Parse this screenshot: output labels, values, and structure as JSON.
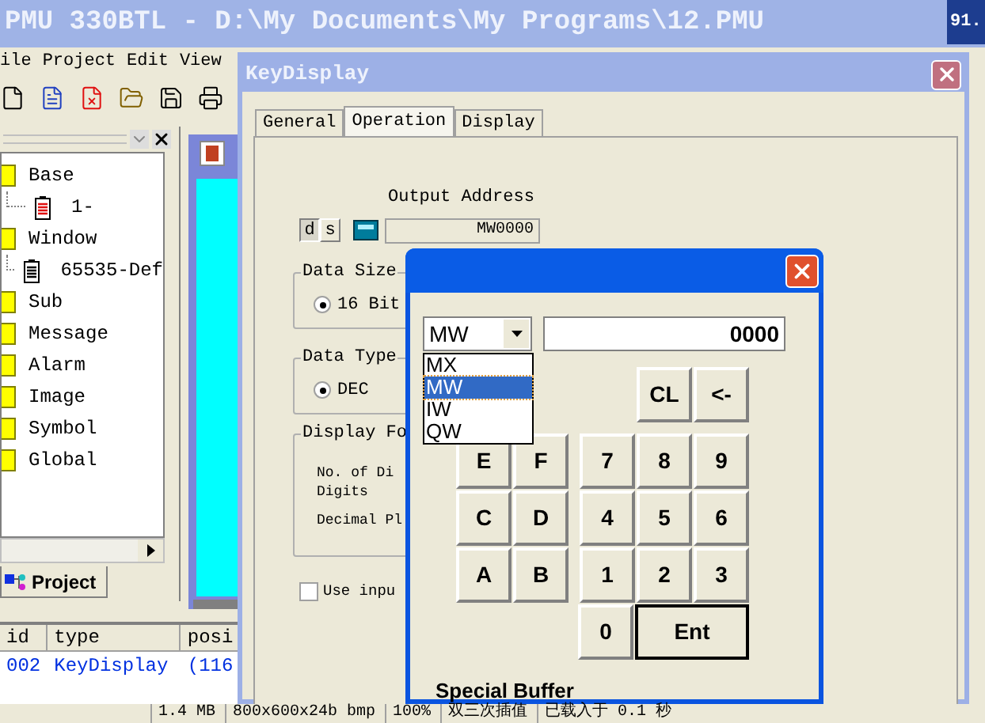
{
  "app": {
    "title": "PMU 330BTL - D:\\My Documents\\My Programs\\12.PMU",
    "corner_text": "91.",
    "menu": [
      "ile",
      "Project",
      "Edit",
      "View"
    ]
  },
  "project_tree": {
    "items": [
      {
        "label": "Base",
        "children": [
          {
            "label": "1-",
            "color": "#e01010"
          }
        ]
      },
      {
        "label": "Window",
        "children": [
          {
            "label": "65535-Def",
            "color": "#000000"
          }
        ]
      },
      {
        "label": "Sub"
      },
      {
        "label": "Message"
      },
      {
        "label": "Alarm"
      },
      {
        "label": "Image"
      },
      {
        "label": "Symbol"
      },
      {
        "label": "Global"
      }
    ],
    "tab": "Project"
  },
  "object_list": {
    "columns": [
      "id",
      "type",
      "posi"
    ],
    "rows": [
      [
        "002",
        "KeyDisplay",
        "(116"
      ]
    ]
  },
  "status_bar": [
    "1.4 MB",
    "800x600x24b bmp",
    "100%",
    "双三次插值",
    "已载入于 0.1 秒"
  ],
  "key_display": {
    "title": "KeyDisplay",
    "tabs": [
      {
        "label": "General",
        "selected": false
      },
      {
        "label": "Operation",
        "selected": true
      },
      {
        "label": "Display",
        "selected": false
      }
    ],
    "output_address": {
      "label": "Output Address",
      "modes": [
        {
          "label": "d",
          "selected": true
        },
        {
          "label": "s",
          "selected": false
        }
      ],
      "value": "MW0000"
    },
    "data_size": {
      "label": "Data Size",
      "option": {
        "label": "16 Bit",
        "selected": true
      }
    },
    "data_type": {
      "label": "Data Type",
      "option": {
        "label": "DEC",
        "selected": true
      }
    },
    "display_format": {
      "label": "Display Fo",
      "lines": [
        "No. of Di",
        "Digits",
        "Decimal Pl"
      ]
    },
    "use_input": {
      "label": "Use inpu",
      "checked": false
    }
  },
  "keypad": {
    "combo": {
      "value": "MW",
      "options": [
        {
          "label": "MX",
          "selected": false
        },
        {
          "label": "MW",
          "selected": true
        },
        {
          "label": "IW",
          "selected": false
        },
        {
          "label": "QW",
          "selected": false
        }
      ]
    },
    "display": "0000",
    "rows": [
      {
        "hex": [],
        "digits": [
          {
            "label": "CL",
            "kind": "normal"
          },
          {
            "label": "<-",
            "kind": "normal"
          }
        ]
      },
      {
        "hex": [
          "E",
          "F"
        ],
        "digits": [
          {
            "label": "7",
            "kind": "normal"
          },
          {
            "label": "8",
            "kind": "normal"
          },
          {
            "label": "9",
            "kind": "normal"
          }
        ]
      },
      {
        "hex": [
          "C",
          "D"
        ],
        "digits": [
          {
            "label": "4",
            "kind": "normal"
          },
          {
            "label": "5",
            "kind": "normal"
          },
          {
            "label": "6",
            "kind": "normal"
          }
        ]
      },
      {
        "hex": [
          "A",
          "B"
        ],
        "digits": [
          {
            "label": "1",
            "kind": "normal"
          },
          {
            "label": "2",
            "kind": "normal"
          },
          {
            "label": "3",
            "kind": "normal"
          }
        ]
      },
      {
        "hex": [],
        "digits": [
          {
            "label": "0",
            "kind": "normal"
          },
          {
            "label": "Ent",
            "kind": "default"
          }
        ]
      }
    ],
    "caption": "Special Buffer"
  }
}
